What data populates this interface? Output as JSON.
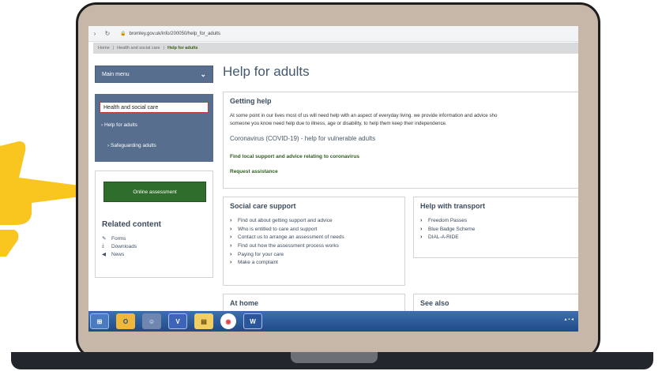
{
  "browser": {
    "url": "bromley.gov.uk/info/200050/help_for_adults"
  },
  "breadcrumb": {
    "home": "Home",
    "level1": "Health and social care",
    "current": "Help for adults"
  },
  "sidebar": {
    "main_menu": "Main menu",
    "section": "Health and social care",
    "item1": "Help for adults",
    "item2": "Safeguarding adults",
    "online_assessment": "Online assessment",
    "related_title": "Related content",
    "related": [
      "Forms",
      "Downloads",
      "News"
    ]
  },
  "page": {
    "title": "Help for adults"
  },
  "getting_help": {
    "title": "Getting help",
    "body_line1": "At some point in our lives most of us will need help with an aspect of everyday living. we provide information and advice sho",
    "body_line2": "someone you know need help due to illness, age or disability, to help them keep their independence.",
    "covid": "Coronavirus (COVID-19) - help for vulnerable adults",
    "link1": "Find local support and advice relating to coronavirus",
    "link2": "Request assistance"
  },
  "social_care": {
    "title": "Social care support",
    "items": [
      "Find out about getting support and advice",
      "Who is entitled to care and support",
      "Contact us to arrange an assessment of needs",
      "Find out how the assessment process works",
      "Paying for your care",
      "Make a complaint"
    ]
  },
  "transport": {
    "title": "Help with transport",
    "items": [
      "Freedom Passes",
      "Blue Badge Scheme",
      "DIAL-A-RIDE"
    ]
  },
  "at_home": {
    "title": "At home"
  },
  "see_also": {
    "title": "See also"
  },
  "icons": {
    "hand": "pointing-hand-icon",
    "menu_chevron": "chevron-down-icon",
    "list_arrow": "chevron-right-icon"
  },
  "colors": {
    "hand": "#f9c51f",
    "laptop_lid": "#c7b7a9",
    "menu": "#586e8f",
    "button": "#2f6d2c",
    "taskbar": "#2a5b9c"
  }
}
